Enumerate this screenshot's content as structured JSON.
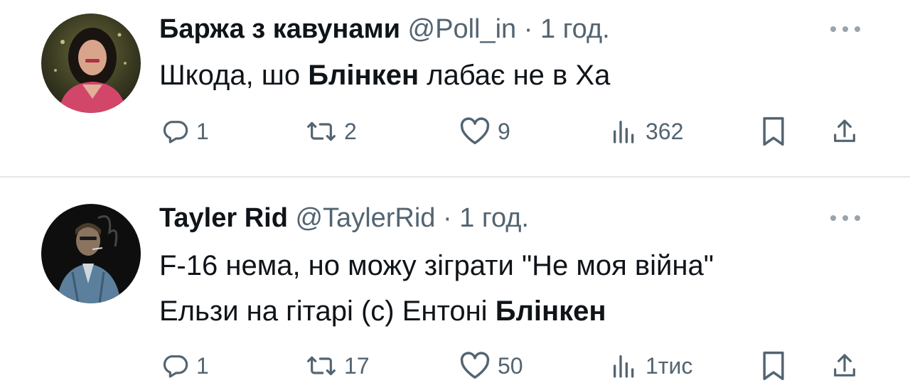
{
  "tweets": [
    {
      "name": "Баржа з кавунами",
      "handle": "@Poll_in",
      "separator": "·",
      "time": "1 год.",
      "text_parts": [
        "Шкода, шо ",
        "Блінкен",
        " лабає не в Ха"
      ],
      "replies": "1",
      "retweets": "2",
      "likes": "9",
      "views": "362"
    },
    {
      "name": "Tayler Rid",
      "handle": "@TaylerRid",
      "separator": "·",
      "time": "1 год.",
      "line1": "F-16 нема, но можу зіграти \"Не моя війна\"",
      "line2_parts": [
        "Ельзи на гітарі (с) Ентоні ",
        "Блінкен"
      ],
      "replies": "1",
      "retweets": "17",
      "likes": "50",
      "views": "1тис"
    }
  ],
  "colors": {
    "text": "#0f1419",
    "secondary": "#536471",
    "divider": "#e3e6e9"
  },
  "icons": [
    "reply-icon",
    "retweet-icon",
    "like-icon",
    "views-icon",
    "bookmark-icon",
    "share-icon",
    "more-icon"
  ]
}
